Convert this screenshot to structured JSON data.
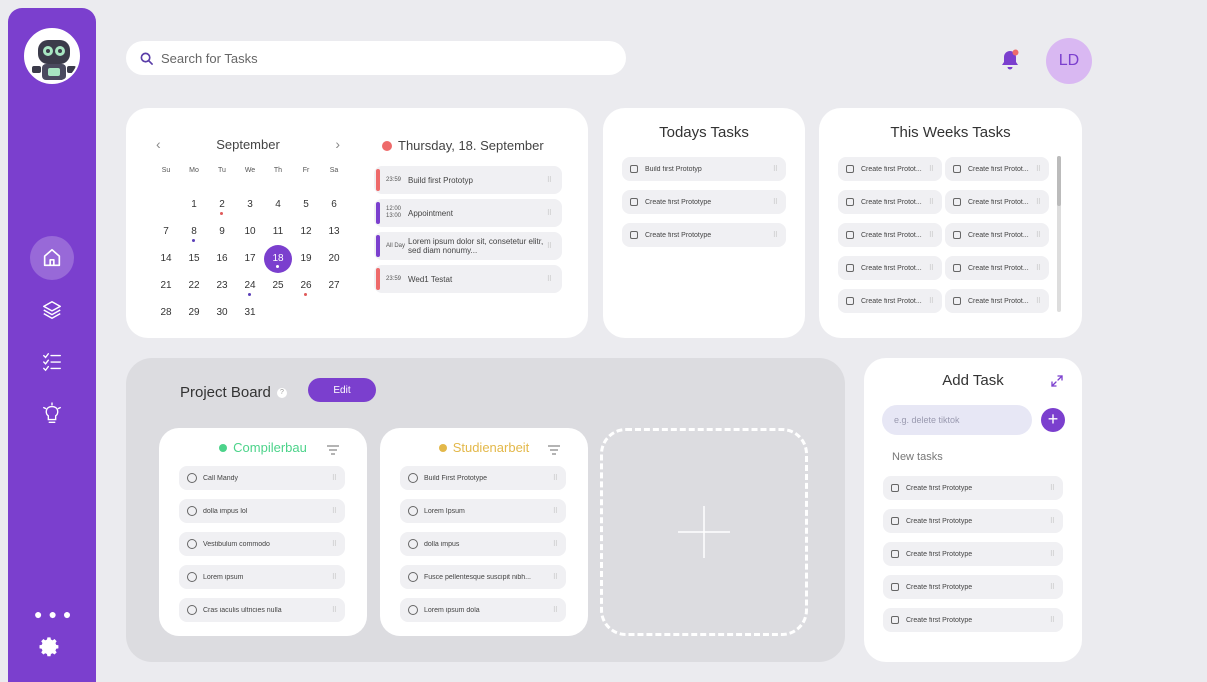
{
  "search": {
    "placeholder": "Search for Tasks"
  },
  "user": {
    "initials": "LD"
  },
  "calendar": {
    "month": "September",
    "prev": "‹",
    "next": "›",
    "weekdays": [
      "Su",
      "Mo",
      "Tu",
      "We",
      "Th",
      "Fr",
      "Sa"
    ],
    "leading_blanks": 1,
    "days": [
      {
        "n": "1"
      },
      {
        "n": "2",
        "dot": "#e05a5a"
      },
      {
        "n": "3"
      },
      {
        "n": "4"
      },
      {
        "n": "5"
      },
      {
        "n": "6"
      },
      {
        "n": "7"
      },
      {
        "n": "8",
        "dot": "#5b3fb8"
      },
      {
        "n": "9"
      },
      {
        "n": "10"
      },
      {
        "n": "11"
      },
      {
        "n": "12"
      },
      {
        "n": "13"
      },
      {
        "n": "14"
      },
      {
        "n": "15"
      },
      {
        "n": "16"
      },
      {
        "n": "17"
      },
      {
        "n": "18",
        "selected": true
      },
      {
        "n": "19"
      },
      {
        "n": "20"
      },
      {
        "n": "21"
      },
      {
        "n": "22"
      },
      {
        "n": "23"
      },
      {
        "n": "24",
        "dot": "#5b3fb8"
      },
      {
        "n": "25"
      },
      {
        "n": "26",
        "dot": "#e05a5a"
      },
      {
        "n": "27"
      },
      {
        "n": "28"
      },
      {
        "n": "29"
      },
      {
        "n": "30"
      },
      {
        "n": "31"
      }
    ]
  },
  "agenda": {
    "title": "Thursday, 18. September",
    "items": [
      {
        "time": "23:59",
        "text": "Build first Prototyp",
        "color": "#ee6a6a"
      },
      {
        "time": "12:00 13:00",
        "text": "Appointment",
        "color": "#7b3fce"
      },
      {
        "time": "All Day",
        "text": "Lorem ipsum dolor sit, consetetur elitr, sed diam nonumy...",
        "color": "#7b3fce"
      },
      {
        "time": "23:59",
        "text": "Wed1 Testat",
        "color": "#ee6a6a"
      }
    ]
  },
  "todays": {
    "title": "Todays Tasks",
    "items": [
      "Build first Prototyp",
      "Create first Prototype",
      "Create first Prototype"
    ]
  },
  "weeks": {
    "title": "This Weeks Tasks",
    "items": [
      "Create first Protot...",
      "Create first Protot...",
      "Create first Protot...",
      "Create first Protot...",
      "Create first Protot...",
      "Create first Protot...",
      "Create first Protot...",
      "Create first Protot...",
      "Create first Protot...",
      "Create first Protot..."
    ]
  },
  "board": {
    "title": "Project Board",
    "help": "?",
    "edit_label": "Edit",
    "columns": [
      {
        "name": "Compilerbau",
        "color": "#4cd38a",
        "dot": "#4cd38a",
        "items": [
          "Call Mandy",
          "dolla impus lol",
          "Vestibulum commodo",
          "Lorem ipsum",
          "Cras iaculis ultricies nulla"
        ]
      },
      {
        "name": "Studienarbeit",
        "color": "#e3b84a",
        "dot": "#e3b84a",
        "items": [
          "Build First Prototype",
          "Lorem Ipsum",
          "dolla impus",
          "Fusce pellentesque suscipit nibh...",
          "Lorem ipsum dola"
        ]
      }
    ]
  },
  "add_task": {
    "title": "Add Task",
    "placeholder": "e.g. delete tiktok",
    "plus": "+",
    "new_label": "New tasks",
    "items": [
      "Create first Prototype",
      "Create first Prototype",
      "Create first Prototype",
      "Create first Prototype",
      "Create first Prototype"
    ]
  },
  "colors": {
    "accent": "#7b3fce",
    "background": "#ebebef",
    "bell": "#7b3fce",
    "bell_dot": "#ee6a6a"
  },
  "icons": [
    "robot-logo-icon",
    "home-icon",
    "layers-icon",
    "checklist-icon",
    "lightbulb-icon",
    "more-dots-icon",
    "gear-icon",
    "search-icon",
    "bell-icon",
    "filter-icon",
    "expand-icon",
    "plus-icon",
    "grip-icon"
  ]
}
